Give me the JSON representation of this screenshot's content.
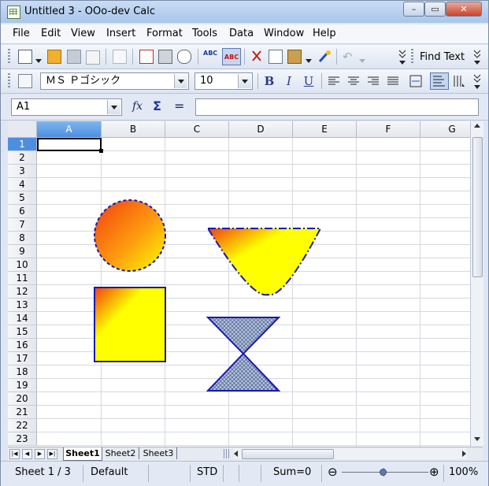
{
  "window": {
    "title": "Untitled 3 - OOo-dev Calc",
    "minimize": "–",
    "restore": "▭",
    "close": "✕"
  },
  "menu": [
    "File",
    "Edit",
    "View",
    "Insert",
    "Format",
    "Tools",
    "Data",
    "Window",
    "Help"
  ],
  "toolbar": {
    "find_text": "Find Text"
  },
  "format": {
    "font_name": "ＭＳ Ｐゴシック",
    "font_size": "10",
    "bold": "B",
    "italic": "I",
    "underline": "U"
  },
  "formula": {
    "name_box": "A1",
    "function_wizard": "fx",
    "sum": "Σ",
    "equals": "=",
    "input": ""
  },
  "columns": [
    "A",
    "B",
    "C",
    "D",
    "E",
    "F",
    "G"
  ],
  "rows": [
    "1",
    "2",
    "3",
    "4",
    "5",
    "6",
    "7",
    "8",
    "9",
    "10",
    "11",
    "12",
    "13",
    "14",
    "15",
    "16",
    "17",
    "18",
    "19",
    "20",
    "21",
    "22",
    "23"
  ],
  "sheets": [
    "Sheet1",
    "Sheet2",
    "Sheet3"
  ],
  "status": {
    "sheet": "Sheet 1 / 3",
    "style": "Default",
    "mode": "STD",
    "sum": "Sum=0",
    "zoom": "100%",
    "zoom_minus": "⊖",
    "zoom_plus": "⊕"
  },
  "colors": {
    "selection": "#4c8fe0",
    "shape_stroke": "#1a1ab0",
    "gradient_start": "#f04010",
    "gradient_end": "#ffff00",
    "hatch": "#8aa4c8"
  }
}
